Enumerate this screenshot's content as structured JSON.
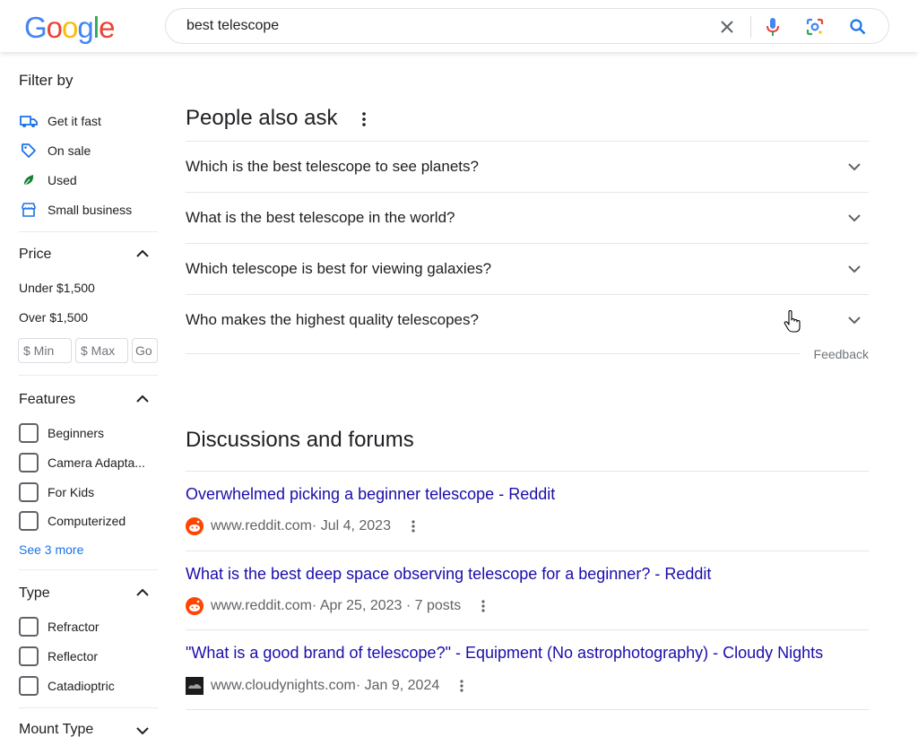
{
  "search": {
    "query": "best telescope"
  },
  "logo": {
    "letters": [
      "G",
      "o",
      "o",
      "g",
      "l",
      "e"
    ],
    "colors": [
      "#4285F4",
      "#EA4335",
      "#FBBC05",
      "#4285F4",
      "#34A853",
      "#EA4335"
    ]
  },
  "sidebar": {
    "filter_title": "Filter by",
    "quick_filters": [
      {
        "label": "Get it fast",
        "icon": "truck-icon"
      },
      {
        "label": "On sale",
        "icon": "tag-icon"
      },
      {
        "label": "Used",
        "icon": "leaf-icon"
      },
      {
        "label": "Small business",
        "icon": "storefront-icon"
      }
    ],
    "price": {
      "title": "Price",
      "options": [
        "Under $1,500",
        "Over $1,500"
      ],
      "min_placeholder": "$ Min",
      "max_placeholder": "$ Max",
      "go_label": "Go"
    },
    "features": {
      "title": "Features",
      "options": [
        "Beginners",
        "Camera Adapta...",
        "For Kids",
        "Computerized"
      ],
      "see_more": "See 3 more"
    },
    "type": {
      "title": "Type",
      "options": [
        "Refractor",
        "Reflector",
        "Catadioptric"
      ]
    },
    "mount_type": {
      "title": "Mount Type"
    }
  },
  "people_also_ask": {
    "title": "People also ask",
    "questions": [
      "Which is the best telescope to see planets?",
      "What is the best telescope in the world?",
      "Which telescope is best for viewing galaxies?",
      "Who makes the highest quality telescopes?"
    ],
    "feedback": "Feedback"
  },
  "discussions": {
    "title": "Discussions and forums",
    "items": [
      {
        "title": "Overwhelmed picking a beginner telescope - Reddit",
        "site": "www.reddit.com",
        "meta": " · Jul 4, 2023",
        "favicon": "reddit-icon"
      },
      {
        "title": "What is the best deep space observing telescope for a beginner? - Reddit",
        "site": "www.reddit.com",
        "meta": " · Apr 25, 2023 · 7 posts",
        "favicon": "reddit-icon"
      },
      {
        "title": "\"What is a good brand of telescope?\" - Equipment (No astrophotography) - Cloudy Nights",
        "site": "www.cloudynights.com",
        "meta": " · Jan 9, 2024",
        "favicon": "cloudynights-icon"
      }
    ]
  },
  "colors": {
    "link": "#1a0dab",
    "accent_blue": "#1a73e8",
    "text": "#202124",
    "muted": "#70757a"
  }
}
